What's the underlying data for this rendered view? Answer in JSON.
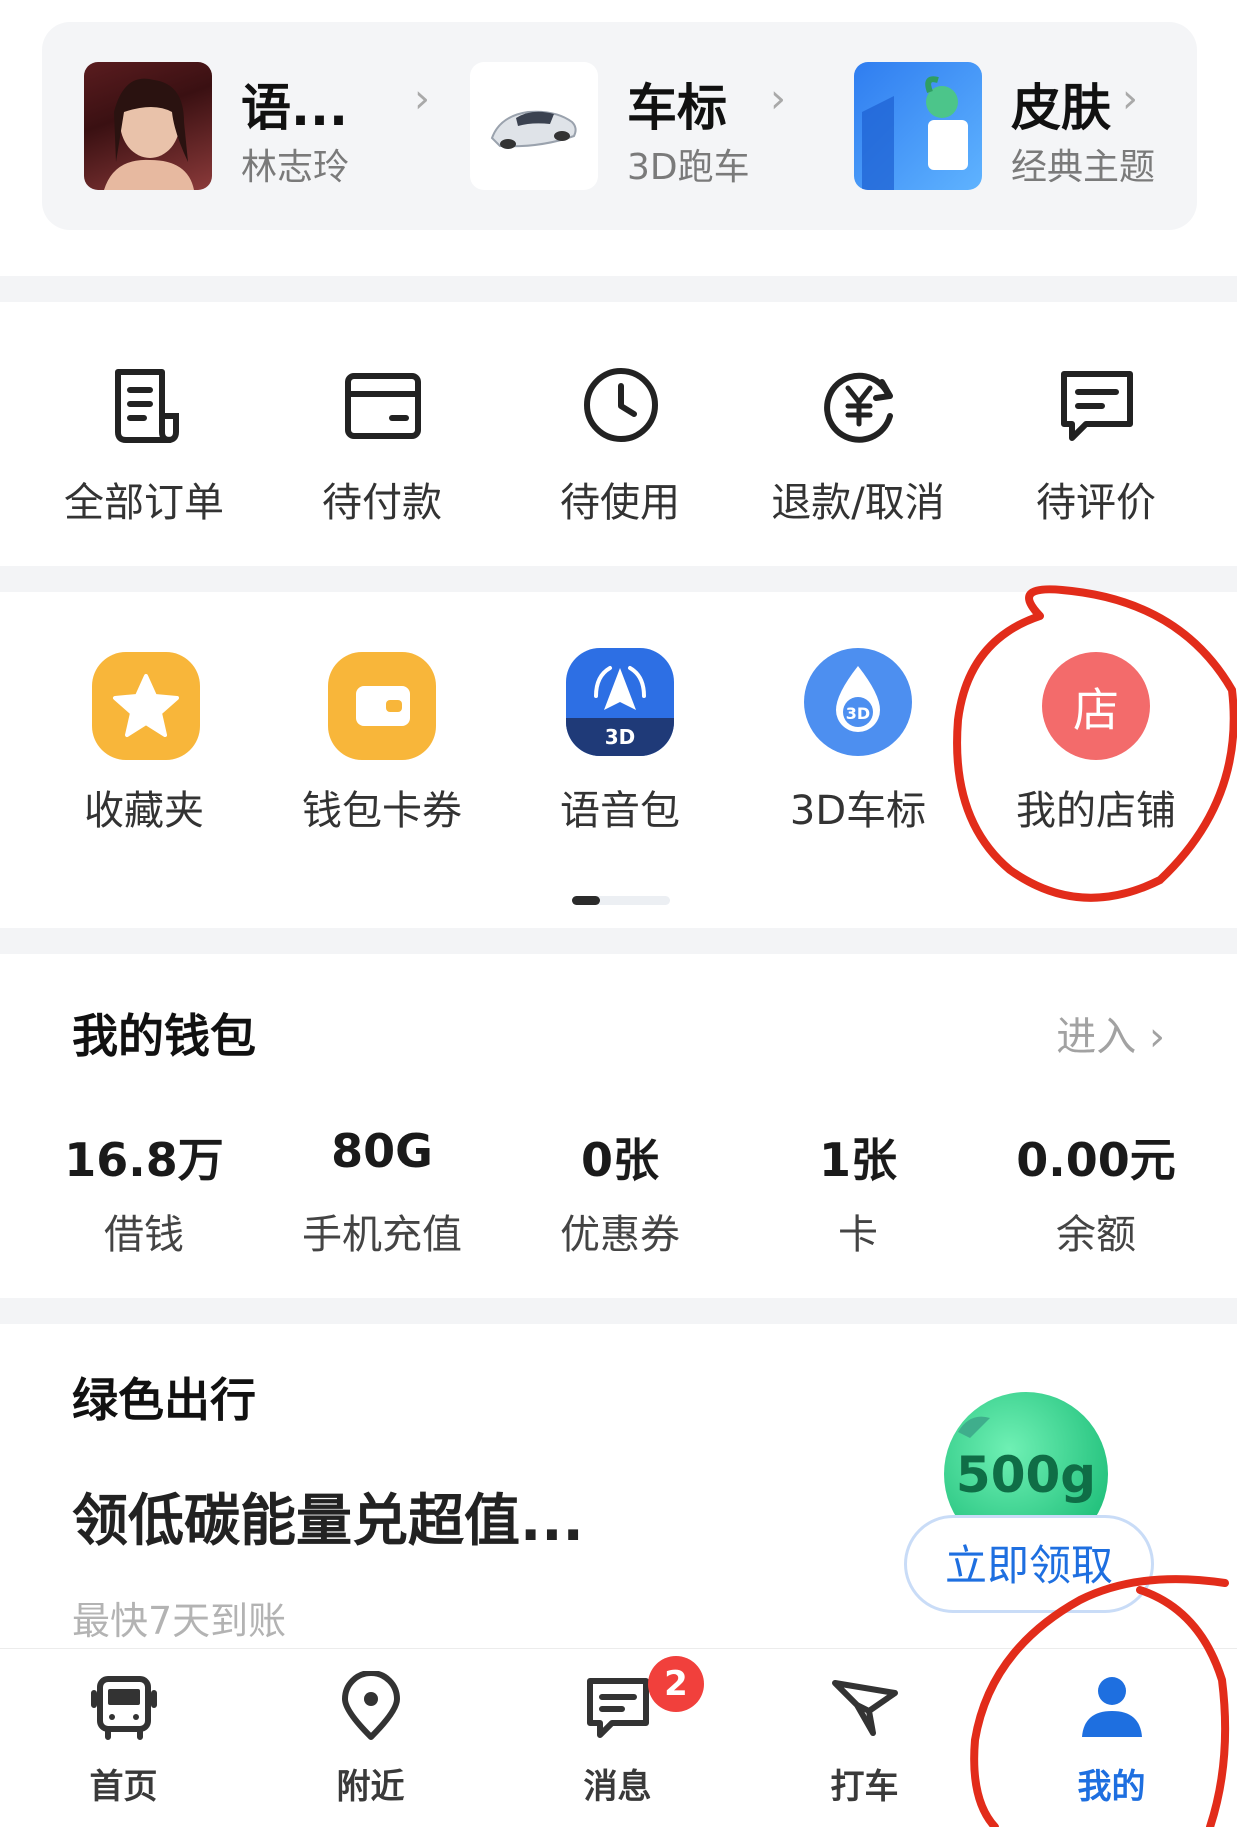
{
  "top_card": {
    "items": [
      {
        "title": "语...",
        "subtitle": "林志玲"
      },
      {
        "title": "车标",
        "subtitle": "3D跑车"
      },
      {
        "title": "皮肤",
        "subtitle": "经典主题"
      }
    ],
    "chevron": "›"
  },
  "orders": [
    {
      "label": "全部订单",
      "icon": "order-list-icon"
    },
    {
      "label": "待付款",
      "icon": "wallet-card-icon"
    },
    {
      "label": "待使用",
      "icon": "clock-icon"
    },
    {
      "label": "退款/取消",
      "icon": "yen-refund-icon"
    },
    {
      "label": "待评价",
      "icon": "comment-icon"
    }
  ],
  "tools": [
    {
      "label": "收藏夹",
      "icon": "star-icon",
      "color": "#f8b63a"
    },
    {
      "label": "钱包卡券",
      "icon": "wallet-icon",
      "color": "#f8b63a"
    },
    {
      "label": "语音包",
      "icon": "voice-pack-3d-icon",
      "color": "#2d6fe4",
      "badge_text": "3D"
    },
    {
      "label": "3D车标",
      "icon": "3d-drop-icon",
      "color": "#4d8ff0",
      "badge_text": "3D"
    },
    {
      "label": "我的店铺",
      "icon": "shop-icon",
      "color": "#f36b6b",
      "badge_text": "店"
    }
  ],
  "wallet": {
    "title": "我的钱包",
    "enter_label": "进入 ›",
    "items": [
      {
        "value": "16.8万",
        "label": "借钱"
      },
      {
        "value": "80G",
        "label": "手机充值"
      },
      {
        "value": "0张",
        "label": "优惠券"
      },
      {
        "value": "1张",
        "label": "卡"
      },
      {
        "value": "0.00元",
        "label": "余额"
      }
    ]
  },
  "green": {
    "title": "绿色出行",
    "headline": "领低碳能量兑超值...",
    "sub": "最快7天到账",
    "energy": "500g",
    "claim_label": "立即领取"
  },
  "nav": {
    "items": [
      {
        "label": "首页",
        "icon": "bus-icon"
      },
      {
        "label": "附近",
        "icon": "location-pin-icon"
      },
      {
        "label": "消息",
        "icon": "message-icon"
      },
      {
        "label": "打车",
        "icon": "taxi-arrow-icon"
      },
      {
        "label": "我的",
        "icon": "user-icon"
      }
    ],
    "message_badge": "2",
    "active_color": "#1e6fe0"
  }
}
